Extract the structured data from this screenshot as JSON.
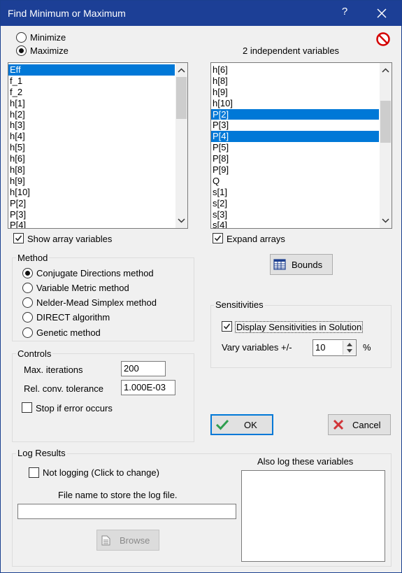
{
  "window": {
    "title": "Find Minimum or Maximum",
    "help_glyph": "?",
    "title_bg": "#1c3f96"
  },
  "objective": {
    "minimize_label": "Minimize",
    "maximize_label": "Maximize",
    "selected": "Maximize"
  },
  "independent_count_label": "2 independent variables",
  "objective_list": {
    "items": [
      "Eff",
      "f_1",
      "f_2",
      "h[1]",
      "h[2]",
      "h[3]",
      "h[4]",
      "h[5]",
      "h[6]",
      "h[8]",
      "h[9]",
      "h[10]",
      "P[2]",
      "P[3]",
      "P[4]"
    ],
    "selected": [
      "Eff"
    ]
  },
  "variable_list": {
    "items": [
      "h[6]",
      "h[8]",
      "h[9]",
      "h[10]",
      "P[2]",
      "P[3]",
      "P[4]",
      "P[5]",
      "P[8]",
      "P[9]",
      "Q",
      "s[1]",
      "s[2]",
      "s[3]",
      "s[4]"
    ],
    "selected": [
      "P[2]",
      "P[4]"
    ]
  },
  "show_array_variables": {
    "label": "Show array variables",
    "checked": true
  },
  "expand_arrays": {
    "label": "Expand arrays",
    "checked": true
  },
  "bounds_button": {
    "label": "Bounds",
    "icon": "table-icon"
  },
  "method": {
    "title": "Method",
    "options": [
      "Conjugate Directions method",
      "Variable Metric method",
      "Nelder-Mead Simplex method",
      "DIRECT algorithm",
      "Genetic method"
    ],
    "selected": "Conjugate Directions method"
  },
  "sensitivities": {
    "title": "Sensitivities",
    "display_label": "Display Sensitivities in Solution",
    "display_checked": true,
    "vary_label": "Vary variables +/-",
    "vary_value": "10",
    "vary_unit": "%"
  },
  "controls": {
    "title": "Controls",
    "max_iterations_label": "Max. iterations",
    "max_iterations_value": "200",
    "tolerance_label": "Rel. conv. tolerance",
    "tolerance_value": "1.000E-03",
    "stop_on_error_label": "Stop if error occurs",
    "stop_on_error_checked": false
  },
  "ok_button": {
    "label": "OK",
    "icon": "checkmark-icon",
    "accent": "#2e9e4f"
  },
  "cancel_button": {
    "label": "Cancel",
    "icon": "x-icon",
    "accent": "#d13438"
  },
  "log_results": {
    "title": "Log Results",
    "logging_label": "Not logging (Click to change)",
    "logging_checked": false,
    "also_log_label": "Also log these variables",
    "file_name_label": "File name to store the log file.",
    "file_name_value": "",
    "browse_label": "Browse",
    "browse_icon": "document-icon"
  },
  "accent": "#0078d7",
  "no_entry_icon_color": "#d40000"
}
